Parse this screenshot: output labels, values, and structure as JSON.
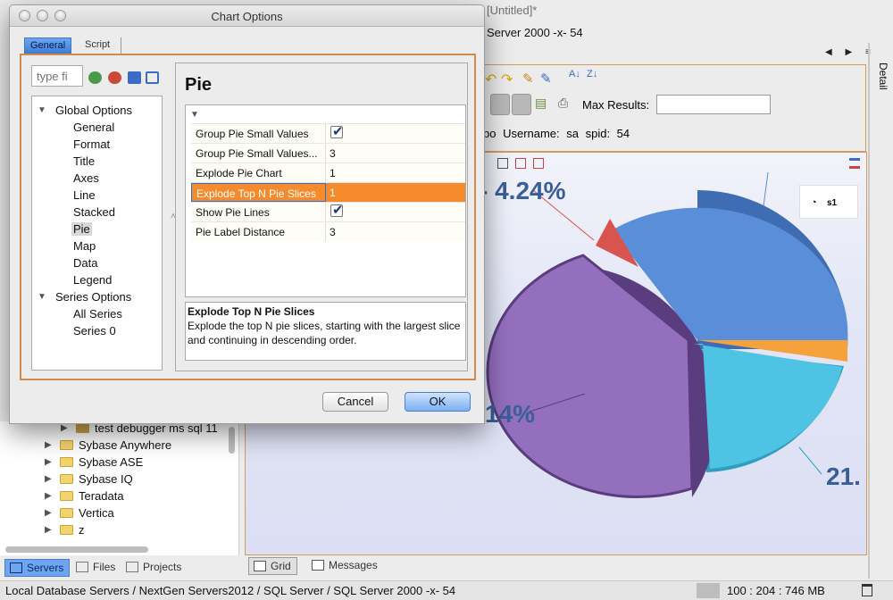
{
  "app": {
    "title": "[Untitled]*",
    "server_line": "Server 2000 -x- 54",
    "nav_arrows": "◀ ▶ ≡",
    "detail_tab": "Detail",
    "toolbar": {
      "max_results_label": "Max Results:",
      "max_results_value": ""
    },
    "connection_info": "bo   Username: sa   spid: 54"
  },
  "chart": {
    "labels": {
      "top": "- 4.24%",
      "left": "14%",
      "right": "21."
    },
    "legend": {
      "series_label": "s1"
    },
    "colors": {
      "blue": "#5b8ed9",
      "orange": "#f5a23d",
      "cyan": "#4fc3e3",
      "purple": "#946fbd",
      "red": "#d9534f"
    }
  },
  "right_bottom_tabs": [
    "Grid",
    "Messages"
  ],
  "left_tree": {
    "items": [
      {
        "label": "test debugger ms sql 11",
        "kind": "db"
      },
      {
        "label": "Sybase Anywhere",
        "kind": "folder"
      },
      {
        "label": "Sybase ASE",
        "kind": "folder"
      },
      {
        "label": "Sybase IQ",
        "kind": "folder"
      },
      {
        "label": "Teradata",
        "kind": "folder"
      },
      {
        "label": "Vertica",
        "kind": "folder"
      },
      {
        "label": "z",
        "kind": "folder"
      }
    ]
  },
  "left_bottom_tabs": [
    "Servers",
    "Files",
    "Projects"
  ],
  "statusbar": {
    "path": "Local Database Servers / NextGen Servers2012 / SQL Server / SQL Server 2000 -x- 54",
    "memory": "100 : 204 : 746 MB"
  },
  "dialog": {
    "title": "Chart Options",
    "tabs": [
      "General",
      "Script"
    ],
    "filter_placeholder": "type fi",
    "tree": {
      "global_options": "Global Options",
      "global_children": [
        "General",
        "Format",
        "Title",
        "Axes",
        "Line",
        "Stacked",
        "Pie",
        "Map",
        "Data",
        "Legend"
      ],
      "series_options": "Series Options",
      "series_children": [
        "All Series",
        "Series 0"
      ],
      "selected": "Pie"
    },
    "pane_title": "Pie",
    "properties": [
      {
        "name": "Group Pie Small Values",
        "type": "check",
        "value": "true"
      },
      {
        "name": "Group Pie Small Values...",
        "type": "text",
        "value": "3"
      },
      {
        "name": "Explode Pie Chart",
        "type": "text",
        "value": "1"
      },
      {
        "name": "Explode Top N Pie Slices",
        "type": "text",
        "value": "1",
        "selected": true
      },
      {
        "name": "Show Pie Lines",
        "type": "check",
        "value": "true"
      },
      {
        "name": "Pie Label Distance",
        "type": "text",
        "value": "3"
      }
    ],
    "description": {
      "title": "Explode Top N Pie Slices",
      "text": "Explode the top N pie slices, starting with the largest slice and continuing in descending order."
    },
    "buttons": {
      "cancel": "Cancel",
      "ok": "OK"
    },
    "accent": "#f58b2d"
  }
}
